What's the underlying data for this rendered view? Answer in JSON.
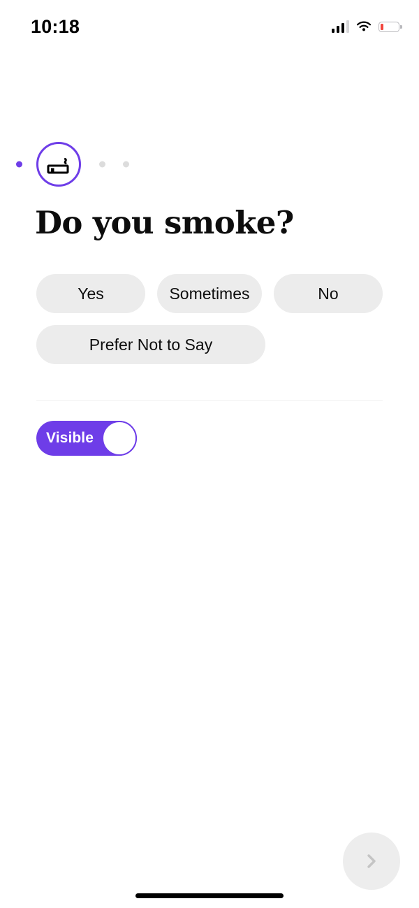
{
  "status_bar": {
    "time": "10:18",
    "signal_icon": "cellular-signal-icon",
    "signal_bars_filled": 3,
    "signal_bars_total": 4,
    "wifi_icon": "wifi-icon",
    "battery_icon": "battery-low-icon",
    "battery_level_percent": 10,
    "battery_color": "#f2453d"
  },
  "progress": {
    "steps": [
      {
        "state": "completed",
        "icon": "dot-icon"
      },
      {
        "state": "current",
        "icon": "cigarette-icon"
      },
      {
        "state": "upcoming",
        "icon": "dot-icon"
      },
      {
        "state": "upcoming",
        "icon": "dot-icon"
      }
    ],
    "active_color": "#6e3de8",
    "inactive_color": "#dcdcdc"
  },
  "main": {
    "title": "Do you smoke?",
    "options": [
      {
        "label": "Yes",
        "selected": false
      },
      {
        "label": "Sometimes",
        "selected": false
      },
      {
        "label": "No",
        "selected": false
      },
      {
        "label": "Prefer Not to Say",
        "selected": false
      }
    ],
    "option_bg_color": "#ececec",
    "option_text_color": "#0d0d0d"
  },
  "visibility": {
    "label": "Visible",
    "state": "on",
    "track_color": "#6e3de8",
    "knob_color": "#ffffff"
  },
  "navigation": {
    "next_label": "",
    "next_icon": "chevron-right-icon",
    "next_enabled": false,
    "next_icon_color": "#c4c4c4",
    "next_bg_color": "#ededed"
  },
  "system": {
    "home_indicator": "home-indicator"
  }
}
